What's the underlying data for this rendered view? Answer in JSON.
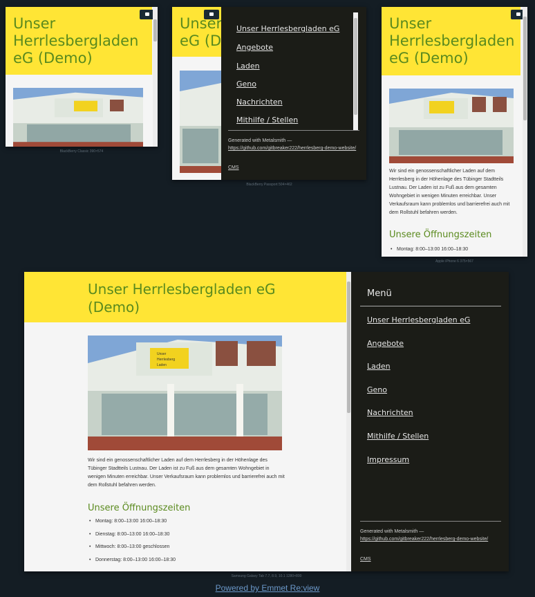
{
  "site": {
    "title": "Unser Herrlesbergladen eG (Demo)",
    "title_line1": "Unser",
    "title_line2": "Herrlesbergladen",
    "title_line3": "eG (Demo)",
    "title_wide_line1": "Unser Herrlesbergladen eG",
    "title_wide_line2": "(Demo)",
    "title_short": "Unser",
    "title_short2": "eG (D"
  },
  "shop_sign": {
    "line1": "Unser",
    "line2": "Herrlesberg",
    "line3": "Laden"
  },
  "intro": "Wir sind ein genossenschaftlicher Laden auf dem Herrlesberg in der Höhenlage des Tübinger Stadtteils Lustnau. Der Laden ist zu Fuß aus dem gesamten Wohngebiet in wenigen Minuten erreichbar. Unser Verkaufsraum kann problemlos und barrierefrei auch mit dem Rollstuhl befahren werden.",
  "hours": {
    "title": "Unsere Öffnungszeiten",
    "items": [
      "Montag: 8:00–13:00 16:00–18:30",
      "Dienstag: 8:00–13:00 16:00–18:30",
      "Mittwoch: 8:00–13:00 geschlossen",
      "Donnerstag: 8:00–13:00 16:00–18:30"
    ]
  },
  "menu": {
    "title": "Menü",
    "items": [
      "Unser Herrlesbergladen eG",
      "Angebote",
      "Laden",
      "Geno",
      "Nachrichten",
      "Mithilfe / Stellen",
      "Impressum"
    ]
  },
  "footer": {
    "generated": "Generated with Metalsmith —",
    "link": "https://github.com/gitbreaker222/herrlesberg-demo-website/",
    "link_part1": "https://github.com/gitbreaker222/herrlesberg-demo-",
    "link_part2": "website/",
    "cms": "CMS"
  },
  "devices": {
    "d1": "BlackBerry Classic   390×574",
    "d2": "BlackBerry Passport   504×462",
    "d3": "Apple iPhone 6   375×567",
    "d4": "Samsung Galaxy Tab 7.7, 8.9, 10.1   1280×800"
  },
  "powered_by": "Powered by Emmet Re:view",
  "colors": {
    "hero": "#ffe535",
    "heading": "#5a8a1e",
    "nav": "#1b1c17",
    "page": "#141d24"
  }
}
